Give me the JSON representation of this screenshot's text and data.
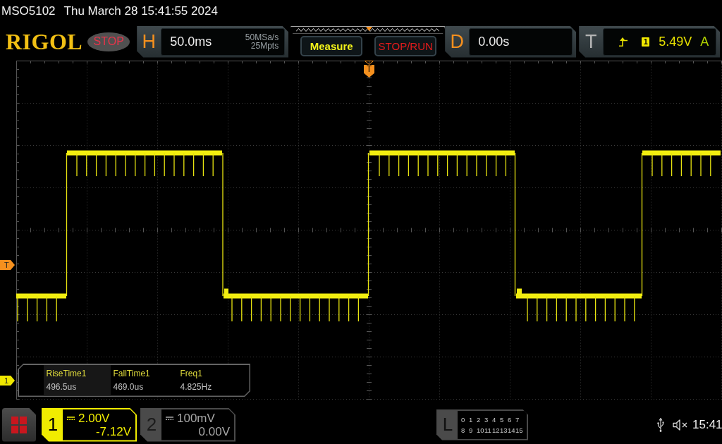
{
  "header": {
    "model": "MSO5102",
    "datetime": "Thu March 28 15:41:55 2024"
  },
  "toolbar": {
    "logo": "RIGOL",
    "run_status": "STOP",
    "horizontal": {
      "label": "H",
      "timebase": "50.0ms",
      "sample_rate": "50MSa/s",
      "memory_depth": "25Mpts"
    },
    "buttons": [
      {
        "label": "Measure",
        "kind": "measure"
      },
      {
        "label": "STOP/RUN",
        "kind": "run_stop"
      }
    ],
    "delay": {
      "label": "D",
      "value": "0.00s"
    },
    "trigger": {
      "label": "T",
      "source": "1",
      "voltage": "5.49V",
      "mode": "A"
    }
  },
  "display": {
    "trigger_position_marker": "T",
    "trigger_level_marker": "T",
    "channel_marker": "1",
    "measurements": [
      {
        "name": "RiseTime1",
        "value": "496.5us",
        "selected": true
      },
      {
        "name": "FallTime1",
        "value": "469.0us",
        "selected": false
      },
      {
        "name": "Freq1",
        "value": "4.825Hz",
        "selected": false
      }
    ]
  },
  "channels": [
    {
      "number": "1",
      "scale": "2.00V",
      "offset": "-7.12V",
      "on": true
    },
    {
      "number": "2",
      "scale": "100mV",
      "offset": "0.00V",
      "on": false
    }
  ],
  "logic": {
    "label": "L",
    "rows": [
      [
        "0",
        "1",
        "2",
        "3",
        "4",
        "5",
        "6",
        "7"
      ],
      [
        "8",
        "9",
        "10",
        "11",
        "12",
        "13",
        "14",
        "15"
      ]
    ]
  },
  "status_bar": {
    "clock": "15:41"
  }
}
